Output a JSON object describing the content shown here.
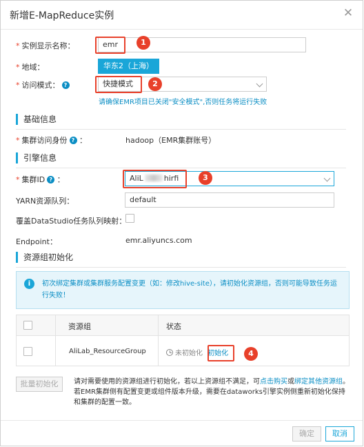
{
  "dialog": {
    "title": "新增E-MapReduce实例",
    "close_icon": "close-icon"
  },
  "form": {
    "instance_name_label": "实例显示名称：",
    "instance_name_value": "emr",
    "region_label": "地域：",
    "region_value": "华东2（上海）",
    "access_mode_label": "访问模式：",
    "access_mode_value": "快捷模式",
    "access_mode_hint": "请确保EMR项目已关闭\"安全模式\",否则任务将运行失败"
  },
  "basic": {
    "section_title": "基础信息",
    "cluster_identity_label": "集群访问身份",
    "cluster_identity_value": "hadoop（EMR集群账号）"
  },
  "engine": {
    "section_title": "引擎信息",
    "cluster_id_label": "集群ID",
    "cluster_id_prefix": "AliL",
    "cluster_id_suffix": "hirfi",
    "yarn_label": "YARN资源队列：",
    "yarn_value": "default",
    "override_label": "覆盖DataStudio任务队列映射：",
    "endpoint_label": "Endpoint：",
    "endpoint_value": "emr.aliyuncs.com"
  },
  "init": {
    "section_title": "资源组初始化",
    "alert_text": "初次绑定集群或集群服务配置变更（如：修改hive-site），请初始化资源组，否则可能导致任务运行失败！",
    "table": {
      "col_group": "资源组",
      "col_status": "状态",
      "rows": [
        {
          "group": "AliLab_ResourceGroup",
          "status": "未初始化",
          "action": "初始化"
        }
      ]
    },
    "batch_button": "批量初始化",
    "note_part1": "请对需要使用的资源组进行初始化，若以上资源组不满足，可",
    "note_link1": "点击购买",
    "note_part2": "或",
    "note_link2": "绑定其他资源组",
    "note_part3": "。若EMR集群侧有配置变更或组件版本升级，需要在dataworks引擎实例侧重新初始化保持和集群的配置一致。"
  },
  "footer": {
    "confirm": "确定",
    "cancel": "取消"
  },
  "annotations": [
    "1",
    "2",
    "3",
    "4"
  ],
  "colors": {
    "accent": "#1aa6d8",
    "link": "#0b8ec4",
    "required": "#e8402a",
    "highlight": "#e8402a"
  }
}
